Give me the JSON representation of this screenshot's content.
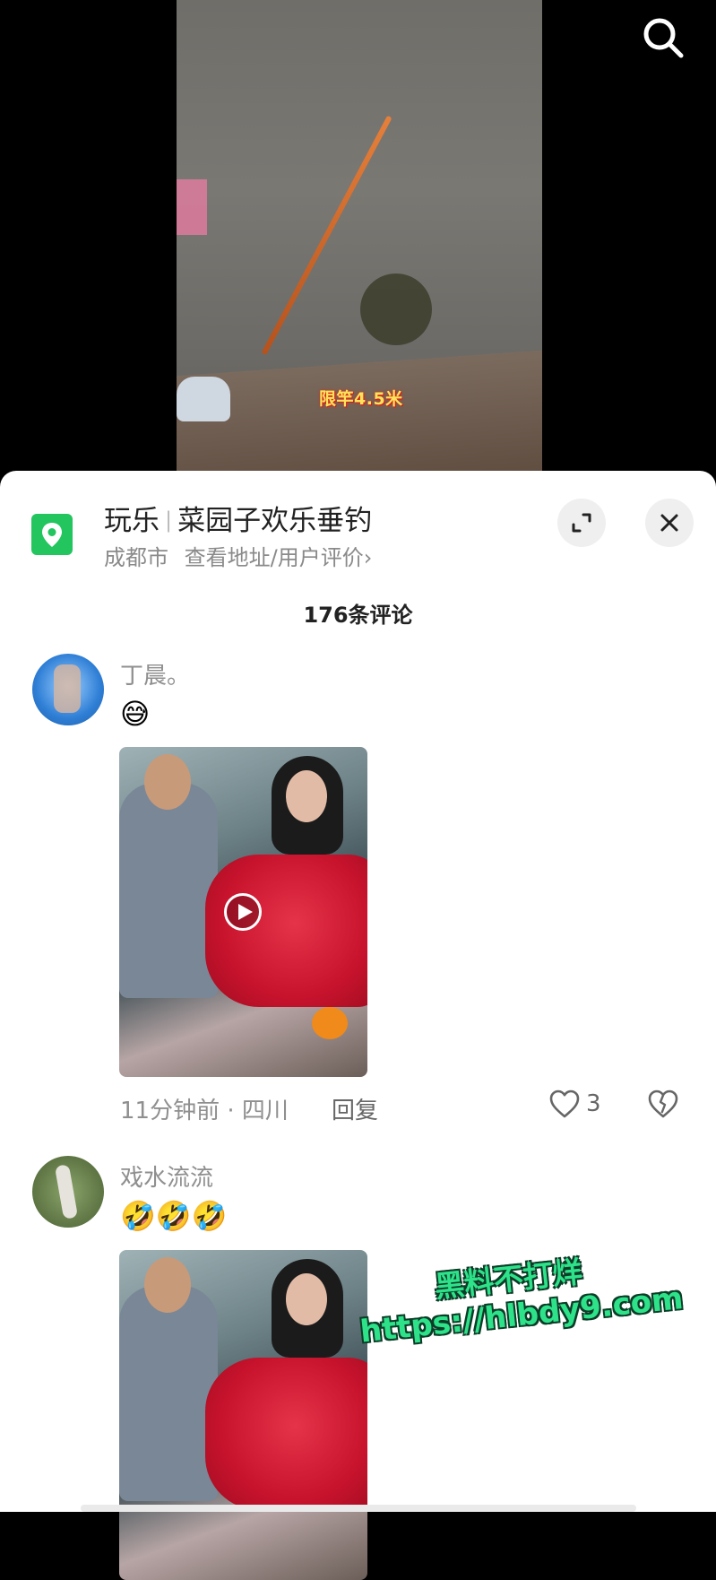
{
  "video": {
    "overlay_caption": "限竿4.5米",
    "search_icon": "search-icon"
  },
  "location": {
    "category": "玩乐",
    "name": "菜园子欢乐垂钓",
    "city": "成都市",
    "link_text": "查看地址/用户评价",
    "link_chevron": "›",
    "accent_color": "#22c55e"
  },
  "comments_header": {
    "title": "176条评论"
  },
  "comments": [
    {
      "username": "丁晨。",
      "emoji": "😅",
      "has_video": true,
      "time_location": "11分钟前 · 四川",
      "reply_label": "回复",
      "like_count": "3"
    },
    {
      "username": "戏水流流",
      "emoji": "🤣🤣🤣",
      "has_video": true
    }
  ],
  "watermark": {
    "line1": "黑料不打烊",
    "line2": "https://hlbdy9.com"
  }
}
